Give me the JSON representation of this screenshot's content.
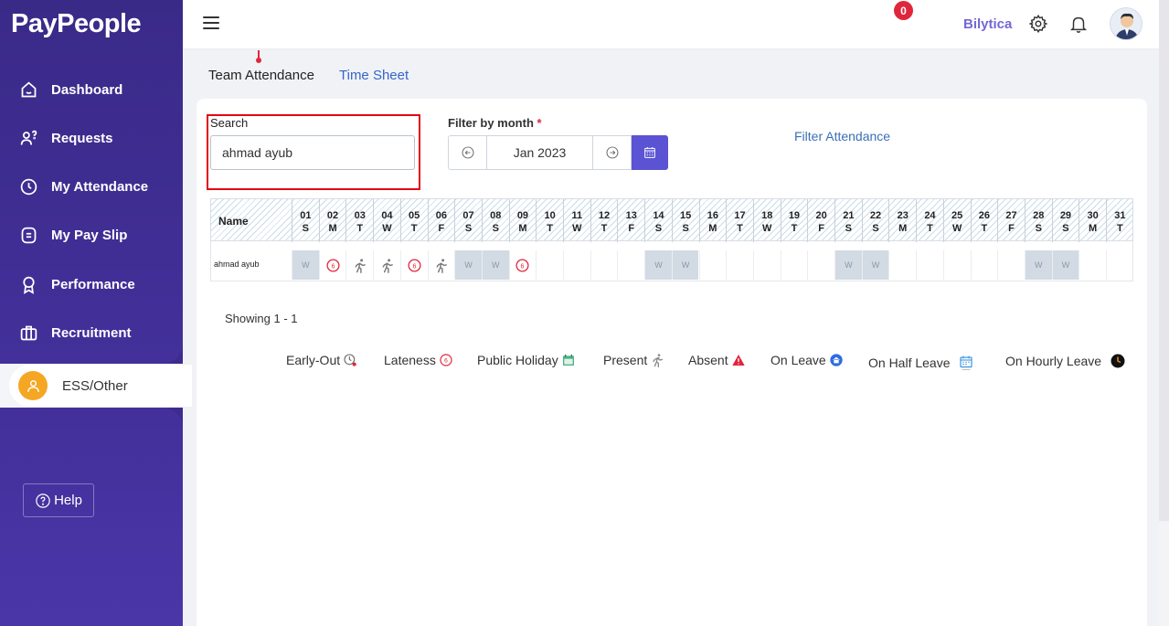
{
  "app": {
    "logo": "PayPeople"
  },
  "sidebar": {
    "items": [
      {
        "label": "Dashboard",
        "icon": "home-icon"
      },
      {
        "label": "Requests",
        "icon": "requests-icon"
      },
      {
        "label": "My Attendance",
        "icon": "clock-icon"
      },
      {
        "label": "My Pay Slip",
        "icon": "payslip-icon"
      },
      {
        "label": "Performance",
        "icon": "award-icon"
      },
      {
        "label": "Recruitment",
        "icon": "briefcase-icon"
      }
    ],
    "active": {
      "label": "ESS/Other",
      "icon": "user-icon"
    },
    "help_label": "Help"
  },
  "header": {
    "company": "Bilytica",
    "notification_count": "0"
  },
  "tabs": [
    {
      "label": "Team Attendance"
    },
    {
      "label": "Time Sheet"
    }
  ],
  "search": {
    "label": "Search",
    "value": "ahmad ayub"
  },
  "filter": {
    "label": "Filter by month",
    "required_mark": "*",
    "month": "Jan 2023",
    "filter_attendance": "Filter Attendance"
  },
  "grid": {
    "name_header": "Name",
    "days": [
      {
        "d": "01",
        "w": "S"
      },
      {
        "d": "02",
        "w": "M"
      },
      {
        "d": "03",
        "w": "T"
      },
      {
        "d": "04",
        "w": "W"
      },
      {
        "d": "05",
        "w": "T"
      },
      {
        "d": "06",
        "w": "F"
      },
      {
        "d": "07",
        "w": "S"
      },
      {
        "d": "08",
        "w": "S"
      },
      {
        "d": "09",
        "w": "M"
      },
      {
        "d": "10",
        "w": "T"
      },
      {
        "d": "11",
        "w": "W"
      },
      {
        "d": "12",
        "w": "T"
      },
      {
        "d": "13",
        "w": "F"
      },
      {
        "d": "14",
        "w": "S"
      },
      {
        "d": "15",
        "w": "S"
      },
      {
        "d": "16",
        "w": "M"
      },
      {
        "d": "17",
        "w": "T"
      },
      {
        "d": "18",
        "w": "W"
      },
      {
        "d": "19",
        "w": "T"
      },
      {
        "d": "20",
        "w": "F"
      },
      {
        "d": "21",
        "w": "S"
      },
      {
        "d": "22",
        "w": "S"
      },
      {
        "d": "23",
        "w": "M"
      },
      {
        "d": "24",
        "w": "T"
      },
      {
        "d": "25",
        "w": "W"
      },
      {
        "d": "26",
        "w": "T"
      },
      {
        "d": "27",
        "w": "F"
      },
      {
        "d": "28",
        "w": "S"
      },
      {
        "d": "29",
        "w": "S"
      },
      {
        "d": "30",
        "w": "M"
      },
      {
        "d": "31",
        "w": "T"
      }
    ],
    "rows": [
      {
        "name": "ahmad ayub",
        "cells": [
          "W",
          "lateness",
          "present",
          "present",
          "lateness",
          "present",
          "W",
          "W",
          "lateness",
          "",
          "",
          "",
          "",
          "W",
          "W",
          "",
          "",
          "",
          "",
          "",
          "W",
          "W",
          "",
          "",
          "",
          "",
          "",
          "W",
          "W",
          "",
          ""
        ]
      }
    ],
    "weekend_label": "W"
  },
  "showing": "Showing 1 - 1",
  "legend": [
    {
      "label": "Early-Out",
      "icon": "early-out-icon"
    },
    {
      "label": "Lateness",
      "icon": "lateness-icon"
    },
    {
      "label": "Public Holiday",
      "icon": "public-holiday-icon"
    },
    {
      "label": "Present",
      "icon": "present-icon"
    },
    {
      "label": "Absent",
      "icon": "absent-icon"
    },
    {
      "label": "On Leave",
      "icon": "on-leave-icon"
    },
    {
      "label": "On Half Leave",
      "icon": "half-leave-icon"
    },
    {
      "label": "On Hourly Leave",
      "icon": "hourly-leave-icon"
    }
  ],
  "colors": {
    "sidebar": "#3d2c8d",
    "accent": "#5b53d4",
    "link": "#3366cc",
    "alert": "#e0263b",
    "highlight": "#e30613",
    "weekend": "#d2dbe4"
  }
}
